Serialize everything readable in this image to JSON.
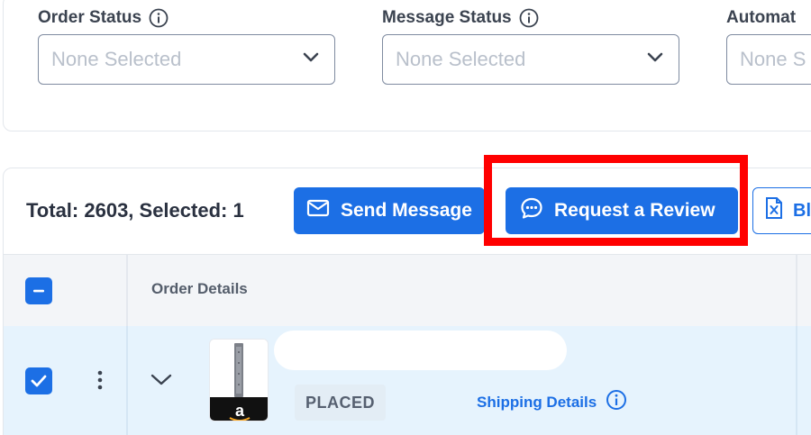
{
  "filters": [
    {
      "label": "Order Status",
      "value": "None Selected"
    },
    {
      "label": "Message Status",
      "value": "None Selected"
    },
    {
      "label": "Automat",
      "value": "None S"
    }
  ],
  "toolbar": {
    "total_text": "Total: 2603, Selected: 1",
    "send_message_label": "Send Message",
    "request_review_label": "Request a Review",
    "outline_button_label": "Bl"
  },
  "table": {
    "header_order_details": "Order Details",
    "rows": [
      {
        "status": "PLACED",
        "shipping_link": "Shipping Details",
        "selected": true
      }
    ]
  },
  "colors": {
    "accent": "#1c6fe5",
    "highlight": "#ff0000",
    "row_selected_bg": "#e6f3fd"
  },
  "icons": [
    "info-icon",
    "chevron-down-icon",
    "envelope-icon",
    "chat-bubble-icon",
    "excel-file-icon",
    "kebab-menu-icon",
    "checkmark-icon",
    "minus-icon"
  ]
}
